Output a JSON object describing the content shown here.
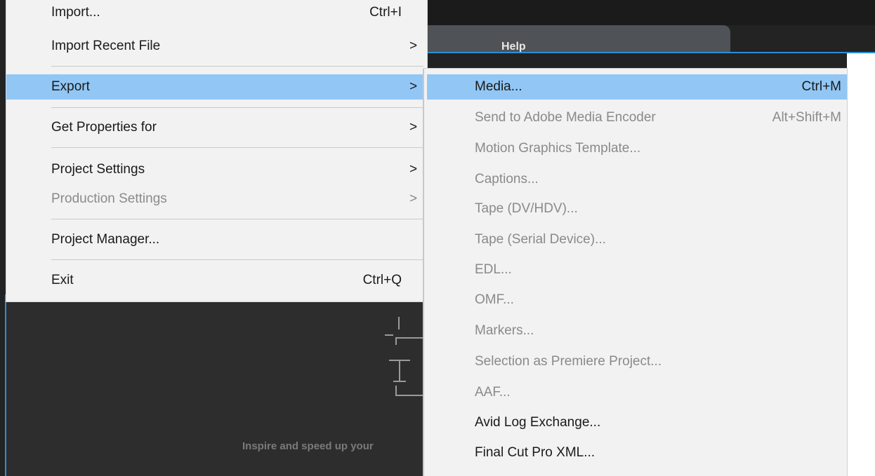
{
  "background": {
    "help_label": "Help",
    "inspire_text": "Inspire and speed up your"
  },
  "file_menu": {
    "items": [
      {
        "label": "Import...",
        "shortcut": "Ctrl+I"
      },
      {
        "label": "Import Recent File",
        "submenu": ">"
      },
      {
        "label": "Export",
        "submenu": ">"
      },
      {
        "label": "Get Properties for",
        "submenu": ">"
      },
      {
        "label": "Project Settings",
        "submenu": ">"
      },
      {
        "label": "Production Settings",
        "submenu": ">",
        "disabled": true
      },
      {
        "label": "Project Manager..."
      },
      {
        "label": "Exit",
        "shortcut": "Ctrl+Q"
      }
    ]
  },
  "export_menu": {
    "items": [
      {
        "label": "Media...",
        "shortcut": "Ctrl+M"
      },
      {
        "label": "Send to Adobe Media Encoder",
        "shortcut": "Alt+Shift+M",
        "disabled": true
      },
      {
        "label": "Motion Graphics Template...",
        "disabled": true
      },
      {
        "label": "Captions...",
        "disabled": true
      },
      {
        "label": "Tape (DV/HDV)...",
        "disabled": true
      },
      {
        "label": "Tape (Serial Device)...",
        "disabled": true
      },
      {
        "label": "EDL...",
        "disabled": true
      },
      {
        "label": "OMF...",
        "disabled": true
      },
      {
        "label": "Markers...",
        "disabled": true
      },
      {
        "label": "Selection as Premiere Project...",
        "disabled": true
      },
      {
        "label": "AAF...",
        "disabled": true
      },
      {
        "label": "Avid Log Exchange..."
      },
      {
        "label": "Final Cut Pro XML..."
      }
    ]
  },
  "colors": {
    "highlight": "#92c7f5",
    "menu_bg": "#f2f2f2",
    "app_bg": "#232323",
    "accent_blue": "#2b8fd6"
  }
}
